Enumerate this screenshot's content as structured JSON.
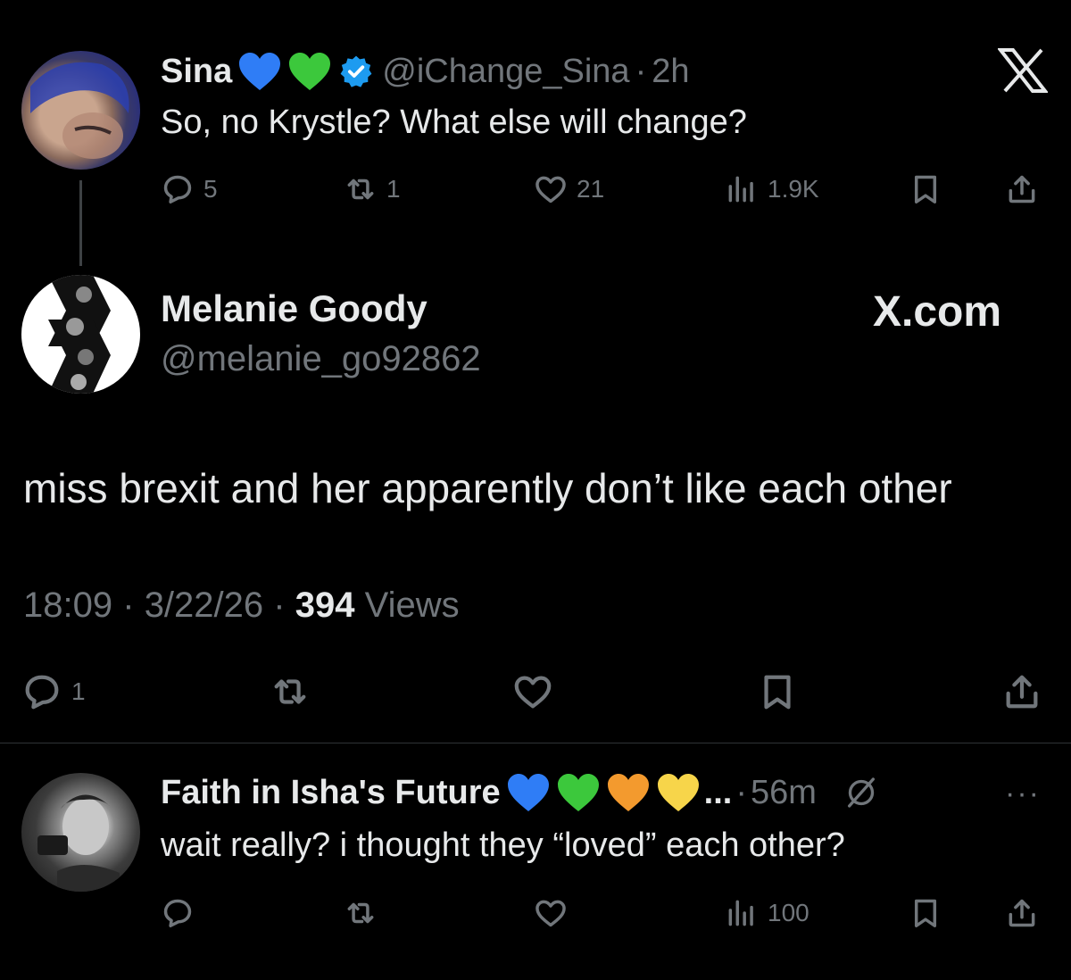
{
  "context_tweet": {
    "display_name": "Sina",
    "handle": "@iChange_Sina",
    "separator": "·",
    "time": "2h",
    "text": "So, no Krystle? What else will change?",
    "heart_colors": [
      "#2f7df6",
      "#3cc83c"
    ],
    "badge": "verified-icon",
    "metrics": {
      "replies": "5",
      "reposts": "1",
      "likes": "21",
      "views": "1.9K"
    }
  },
  "main_tweet": {
    "display_name": "Melanie Goody",
    "handle": "@melanie_go92862",
    "watermark": "X.com",
    "text": "miss brexit and her apparently don’t like each other",
    "time": "18:09",
    "date": "3/22/26",
    "separator": "·",
    "views_count": "394",
    "views_label": "Views",
    "metrics": {
      "replies": "1"
    }
  },
  "reply_tweet": {
    "display_name": "Faith in Isha's Future",
    "heart_colors": [
      "#2f7df6",
      "#3cc83c",
      "#f39a2e",
      "#f7d54a"
    ],
    "ellipsis": "...",
    "separator": "·",
    "time": "56m",
    "more": "···",
    "text": "wait really? i thought they “loved” each other?",
    "metrics": {
      "views": "100"
    }
  },
  "colors": {
    "background": "#000000",
    "text": "#e7e9ea",
    "muted": "#71767b",
    "verified": "#1d9bf0"
  }
}
